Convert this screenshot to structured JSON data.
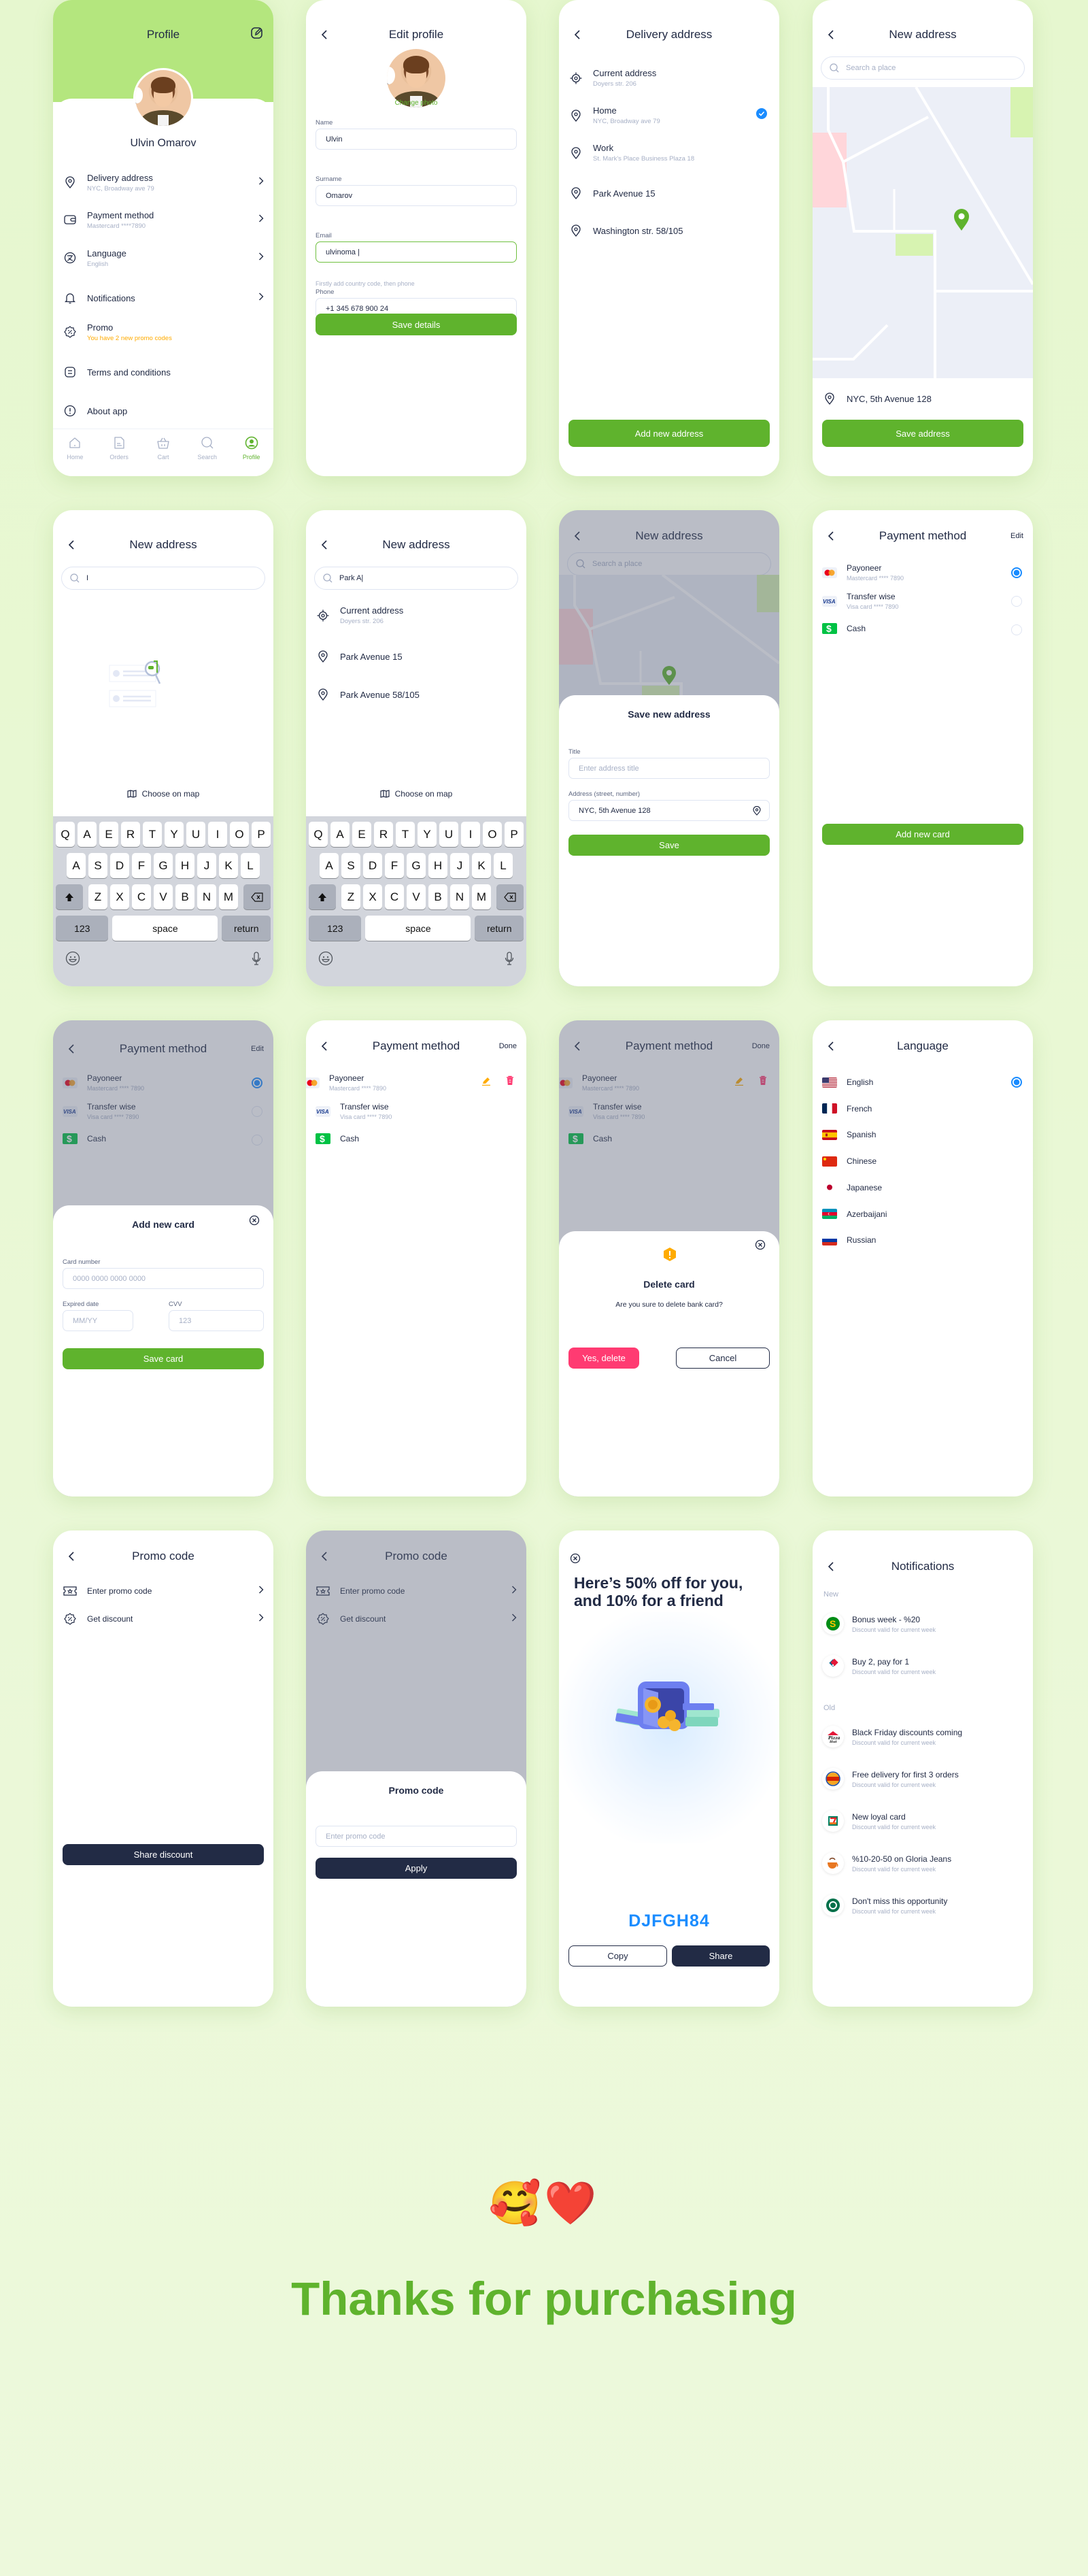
{
  "colors": {
    "brand_green": "#5fb32d",
    "header_green": "#b4e67e",
    "navy": "#222b45",
    "muted": "#a7b0c6",
    "danger": "#ff3b72",
    "selected_blue": "#1a8cff",
    "promo_orange": "#ffab00",
    "code_blue": "#1a8cff",
    "background": "#e9f8d3"
  },
  "profile": {
    "title": "Profile",
    "edit_icon": "edit-icon",
    "user_name": "Ulvin Omarov",
    "menu": [
      {
        "icon": "location-pin-icon",
        "label": "Delivery address",
        "sub": "NYC, Broadway ave 79",
        "chevron": true
      },
      {
        "icon": "wallet-icon",
        "label": "Payment method",
        "sub": "Mastercard ****7890",
        "chevron": true
      },
      {
        "icon": "translate-icon",
        "label": "Language",
        "sub": "English",
        "chevron": true
      },
      {
        "icon": "bell-icon",
        "label": "Notifications",
        "sub": "",
        "chevron": true
      },
      {
        "icon": "discount-badge-icon",
        "label": "Promo",
        "sub": "You have 2 new promo codes",
        "chevron": false
      },
      {
        "icon": "document-icon",
        "label": "Terms and conditions",
        "sub": "",
        "chevron": false
      },
      {
        "icon": "info-icon",
        "label": "About app",
        "sub": "",
        "chevron": false
      }
    ],
    "nav": [
      {
        "icon": "home-icon",
        "label": "Home",
        "active": false
      },
      {
        "icon": "orders-icon",
        "label": "Orders",
        "active": false
      },
      {
        "icon": "cart-icon",
        "label": "Cart",
        "active": false
      },
      {
        "icon": "search-icon",
        "label": "Search",
        "active": false
      },
      {
        "icon": "profile-icon",
        "label": "Profile",
        "active": true
      }
    ]
  },
  "edit_profile": {
    "title": "Edit profile",
    "change_photo": "Change photo",
    "fields": [
      {
        "label": "Name",
        "value": "Ulvin"
      },
      {
        "label": "Surname",
        "value": "Omarov"
      },
      {
        "label": "Email",
        "value": "ulvinoma |"
      },
      {
        "label": "Phone",
        "value": "+1 345 678 900 24"
      }
    ],
    "phone_hint": "Firstly add country code, then phone",
    "save": "Save details"
  },
  "delivery_address": {
    "title": "Delivery address",
    "items": [
      {
        "icon": "target-icon",
        "label": "Current address",
        "sub": "Doyers str. 206",
        "selected": false
      },
      {
        "icon": "location-pin-icon",
        "label": "Home",
        "sub": "NYC, Broadway ave 79",
        "selected": true
      },
      {
        "icon": "location-pin-icon",
        "label": "Work",
        "sub": "St. Mark's Place Business Plaza 18",
        "selected": false
      },
      {
        "icon": "location-pin-icon",
        "label": "Park Avenue 15",
        "sub": "",
        "selected": false
      },
      {
        "icon": "location-pin-icon",
        "label": "Washington str. 58/105",
        "sub": "",
        "selected": false
      }
    ],
    "add": "Add new address"
  },
  "new_address_map": {
    "title": "New address",
    "search_placeholder": "Search a place",
    "address": "NYC, 5th Avenue 128",
    "save": "Save address"
  },
  "new_address_empty": {
    "title": "New address",
    "search_value": "I",
    "choose_on_map": "Choose on map"
  },
  "new_address_results": {
    "title": "New address",
    "search_value": "Park A|",
    "items": [
      {
        "icon": "target-icon",
        "label": "Current address",
        "sub": "Doyers str. 206"
      },
      {
        "icon": "location-pin-icon",
        "label": "Park Avenue 15",
        "sub": ""
      },
      {
        "icon": "location-pin-icon",
        "label": "Park Avenue 58/105",
        "sub": ""
      }
    ],
    "choose_on_map": "Choose on map"
  },
  "keyboard": {
    "row1": [
      "Q",
      "A",
      "E",
      "R",
      "T",
      "Y",
      "U",
      "I",
      "O",
      "P"
    ],
    "row2": [
      "A",
      "S",
      "D",
      "F",
      "G",
      "H",
      "J",
      "K",
      "L"
    ],
    "row3": [
      "Z",
      "X",
      "C",
      "V",
      "B",
      "N",
      "M"
    ],
    "numbers": "123",
    "space": "space",
    "return": "return"
  },
  "save_new_address": {
    "title": "New address",
    "search_placeholder": "Search a place",
    "sheet_title": "Save new address",
    "title_label": "Title",
    "title_placeholder": "Enter address title",
    "address_label": "Address (street, number)",
    "address_value": "NYC, 5th Avenue 128",
    "save": "Save"
  },
  "payment": {
    "title": "Payment method",
    "edit": "Edit",
    "done": "Done",
    "methods": [
      {
        "logo": "mastercard-logo",
        "name": "Payoneer",
        "sub": "Mastercard **** 7890",
        "selected": true
      },
      {
        "logo": "visa-logo",
        "name": "Transfer wise",
        "sub": "Visa card **** 7890",
        "selected": false
      },
      {
        "logo": "cash-logo",
        "name": "Cash",
        "sub": "",
        "selected": false
      }
    ],
    "add_card": "Add new card"
  },
  "add_card_sheet": {
    "title": "Add new card",
    "card_label": "Card number",
    "card_placeholder": "0000 0000 0000 0000",
    "exp_label": "Expired date",
    "exp_placeholder": "MM/YY",
    "cvv_label": "CVV",
    "cvv_placeholder": "123",
    "save": "Save card"
  },
  "delete_card": {
    "title": "Delete card",
    "message": "Are you sure to delete bank card?",
    "confirm": "Yes, delete",
    "cancel": "Cancel"
  },
  "language": {
    "title": "Language",
    "items": [
      {
        "flag": "us-flag",
        "label": "English",
        "selected": true
      },
      {
        "flag": "france-flag",
        "label": "French",
        "selected": false
      },
      {
        "flag": "spain-flag",
        "label": "Spanish",
        "selected": false
      },
      {
        "flag": "china-flag",
        "label": "Chinese",
        "selected": false
      },
      {
        "flag": "japan-flag",
        "label": "Japanese",
        "selected": false
      },
      {
        "flag": "azerbaijan-flag",
        "label": "Azerbaijani",
        "selected": false
      },
      {
        "flag": "russia-flag",
        "label": "Russian",
        "selected": false
      }
    ]
  },
  "promo": {
    "title": "Promo code",
    "items": [
      {
        "icon": "ticket-icon",
        "label": "Enter promo code"
      },
      {
        "icon": "discount-badge-icon",
        "label": "Get discount"
      }
    ],
    "share": "Share discount",
    "sheet_title": "Promo code",
    "input_placeholder": "Enter promo code",
    "apply": "Apply"
  },
  "referral": {
    "headline": "Here’s 50% off for you, and 10% for a friend",
    "code": "DJFGH84",
    "copy": "Copy",
    "share": "Share"
  },
  "notifications": {
    "title": "Notifications",
    "new_label": "New",
    "old_label": "Old",
    "new": [
      {
        "brand": "subway-logo",
        "title": "Bonus week - %20",
        "sub": "Discount valid for current week"
      },
      {
        "brand": "dominos-logo",
        "title": "Buy 2, pay for 1",
        "sub": "Discount valid for current week"
      }
    ],
    "old": [
      {
        "brand": "pizza-hut-logo",
        "title": "Black Friday discounts coming",
        "sub": "Discount valid for current week"
      },
      {
        "brand": "burger-king-logo",
        "title": "Free delivery for first 3 orders",
        "sub": "Discount valid for current week"
      },
      {
        "brand": "seven-eleven-logo",
        "title": "New loyal card",
        "sub": "Discount valid for current week"
      },
      {
        "brand": "gloria-jeans-logo",
        "title": "%10-20-50 on Gloria Jeans",
        "sub": "Discount valid for current week"
      },
      {
        "brand": "starbucks-logo",
        "title": "Don't miss this opportunity",
        "sub": "Discount valid for current week"
      }
    ]
  },
  "footer": {
    "emojis": "🥰❤️",
    "thanks": "Thanks for purchasing"
  }
}
